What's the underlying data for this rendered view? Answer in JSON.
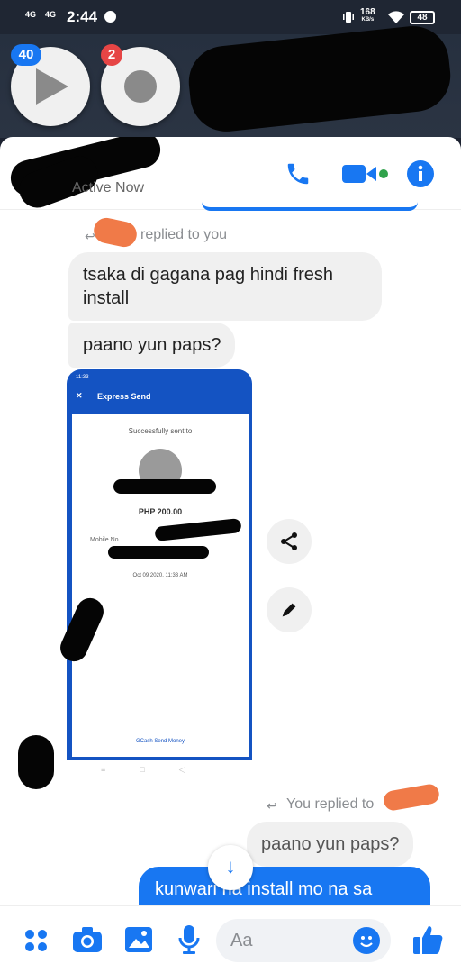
{
  "status_bar": {
    "network_1": "4G",
    "network_2": "4G",
    "time": "2:44",
    "speed_value": "168",
    "speed_unit": "KB/s",
    "battery": "48"
  },
  "chat_heads": {
    "video_badge": "40",
    "messenger_badge": "2"
  },
  "header": {
    "status_text": "Active Now"
  },
  "messages": {
    "reply_note_1": "replied to you",
    "bubble_1": "tsaka di gagana pag hindi fresh install",
    "bubble_2": "paano yun paps?",
    "reply_note_2": "You replied to",
    "quoted_bubble": "paano yun paps?",
    "outgoing_bubble": "kunwari na install mo na sa"
  },
  "attachment": {
    "status_time": "11:33",
    "header_title": "Express Send",
    "sent_label": "Successfully sent to",
    "amount": "PHP 200.00",
    "mobile_label": "Mobile No.",
    "date": "Oct 09 2020, 11:33 AM",
    "footer": "GCash Send Money"
  },
  "composer": {
    "placeholder": "Aa"
  },
  "colors": {
    "accent": "#1877f2",
    "bubble_gray": "#f0f0f0",
    "header_dark": "#1f2633",
    "redaction_orange": "#f07a48",
    "badge_red": "#e64545"
  },
  "icons": [
    "phone-icon",
    "video-icon",
    "info-icon",
    "share-icon",
    "edit-icon",
    "down-arrow-icon",
    "menu-icon",
    "camera-icon",
    "image-icon",
    "microphone-icon",
    "emoji-icon",
    "like-icon"
  ]
}
